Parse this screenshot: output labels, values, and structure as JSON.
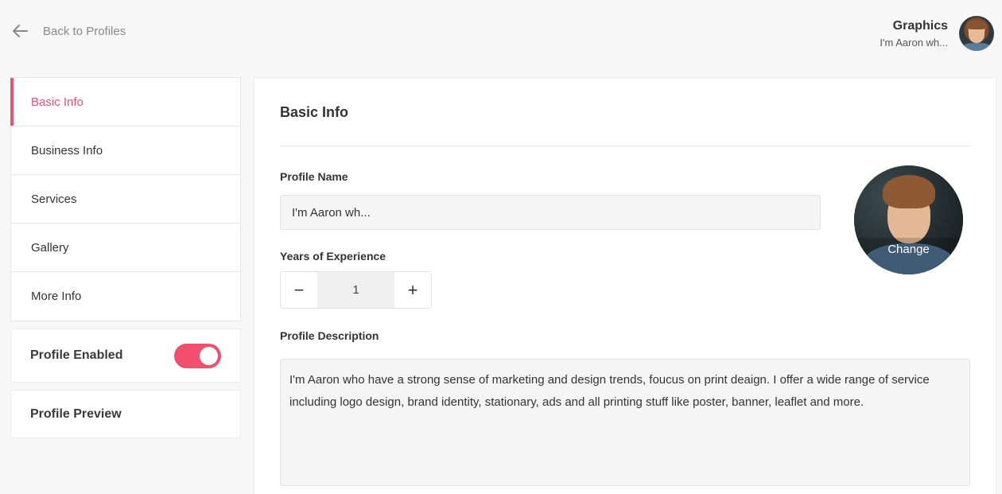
{
  "header": {
    "back_label": "Back to Profiles",
    "user_title": "Graphics",
    "user_subtitle": "I'm Aaron wh..."
  },
  "sidebar": {
    "items": [
      {
        "label": "Basic Info",
        "active": true
      },
      {
        "label": "Business Info",
        "active": false
      },
      {
        "label": "Services",
        "active": false
      },
      {
        "label": "Gallery",
        "active": false
      },
      {
        "label": "More Info",
        "active": false
      }
    ],
    "profile_enabled_label": "Profile Enabled",
    "profile_enabled": true,
    "profile_preview_label": "Profile Preview"
  },
  "main": {
    "title": "Basic Info",
    "profile_name_label": "Profile Name",
    "profile_name_value": "I'm Aaron wh...",
    "experience_label": "Years of Experience",
    "experience_value": "1",
    "minus_symbol": "−",
    "plus_symbol": "+",
    "description_label": "Profile Description",
    "description_value": "I'm Aaron who have a strong sense of marketing and design trends, foucus on print deaign. I offer a wide range of service including logo design, brand identity, stationary, ads and all printing stuff like poster, banner, leaflet and more.",
    "photo_change_label": "Change"
  },
  "colors": {
    "accent": "#f0506e",
    "background": "#f7f7f7"
  },
  "icons": {
    "back": "arrow-left-icon"
  }
}
